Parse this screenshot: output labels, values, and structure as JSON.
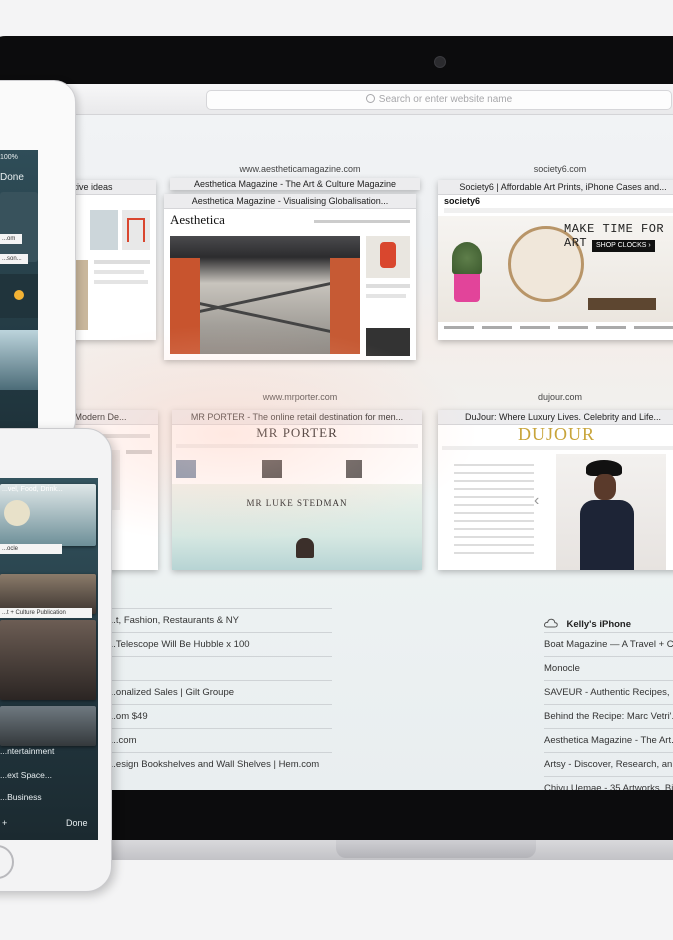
{
  "safari": {
    "search_placeholder": "Search or enter website name",
    "top_sites": [
      {
        "site": "",
        "title": "...ative ideas"
      },
      {
        "site": "www.aestheticamagazine.com",
        "title_back": "Aesthetica Magazine - The Art & Culture Magazine",
        "title": "Aesthetica Magazine - Visualising Globalisation...",
        "logo": "Aesthetica"
      },
      {
        "site": "society6.com",
        "title": "Society6 | Affordable Art Prints, iPhone Cases and...",
        "logo": "society6",
        "banner": "MAKE TIME FOR ART",
        "button": "SHOP CLOCKS ›"
      },
      {
        "site": "",
        "title": "...: Modern De..."
      },
      {
        "site": "www.mrporter.com",
        "title": "MR PORTER - The online retail destination for men...",
        "logo": "MR PORTER",
        "headline": "MR LUKE STEDMAN"
      },
      {
        "site": "dujour.com",
        "title": "DuJour: Where Luxury Lives. Celebrity and Life...",
        "logo": "DUJOUR"
      }
    ],
    "history_left": [
      "...t, Fashion, Restaurants & NY",
      "...Telescope Will Be Hubble x 100",
      "...",
      "...onalized Sales | Gilt Groupe",
      "...om $49",
      "....com",
      "...esign Bookshelves and Wall Shelves | Hem.com"
    ],
    "device_name": "Kelly's iPhone",
    "history_right": [
      "Boat Magazine — A Travel + C...",
      "Monocle",
      "SAVEUR - Authentic Recipes, ...",
      "Behind the Recipe: Marc Vetri'...",
      "Aesthetica Magazine - The Art...",
      "Artsy - Discover, Research, an...",
      "Chiyu Uemae - 35 Artworks, Bi..."
    ]
  },
  "ipad": {
    "status": "100%",
    "done_label": "Done",
    "chips": [
      "...om",
      "...son..."
    ]
  },
  "iphone": {
    "tab1": "...vel, Food, Drink...",
    "tab2": "...ocle",
    "tab3": "...t + Culture Publication",
    "tab4": "...ntertainment",
    "tab5": "...ext Space...",
    "tab6": "...Business",
    "left_label": "+",
    "done_label": "Done"
  }
}
